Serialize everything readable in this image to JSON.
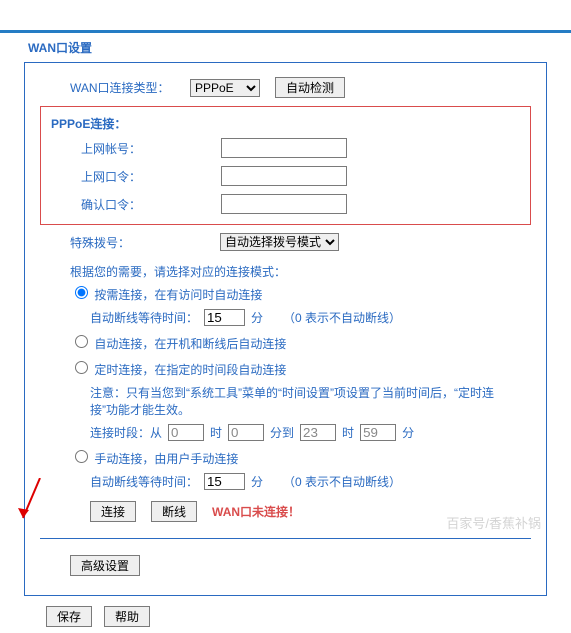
{
  "panelTitle": "WAN口设置",
  "labels": {
    "connType": "WAN口连接类型：",
    "pppoeSection": "PPPoE连接：",
    "account": "上网帐号：",
    "password": "上网口令：",
    "confirm": "确认口令：",
    "special": "特殊拨号："
  },
  "connTypeValue": "PPPoE",
  "autoDetect": "自动检测",
  "specialDialValue": "自动选择拨号模式",
  "modeHint": "根据您的需要，请选择对应的连接模式：",
  "modes": {
    "onDemand": "按需连接，在有访问时自动连接",
    "auto": "自动连接，在开机和断线后自动连接",
    "timed": "定时连接，在指定的时间段自动连接",
    "manual": "手动连接，由用户手动连接"
  },
  "waitLabel": "自动断线等待时间：",
  "waitValue1": "15",
  "waitValue2": "15",
  "minuteUnit": "分",
  "zeroNote": "（0 表示不自动断线）",
  "timedNote": "注意：只有当您到“系统工具”菜单的“时间设置”项设置了当前时间后，“定时连接”功能才能生效。",
  "period": {
    "label": "连接时段：从",
    "h1": "0",
    "m1": "0",
    "to": "分到",
    "h2": "23",
    "m2": "59",
    "hUnit": "时",
    "mUnit": "分"
  },
  "buttons": {
    "connect": "连接",
    "disconnect": "断线",
    "advanced": "高级设置",
    "save": "保存",
    "help": "帮助"
  },
  "status": "WAN口未连接！",
  "watermark": "百家号/香蕉补锅"
}
